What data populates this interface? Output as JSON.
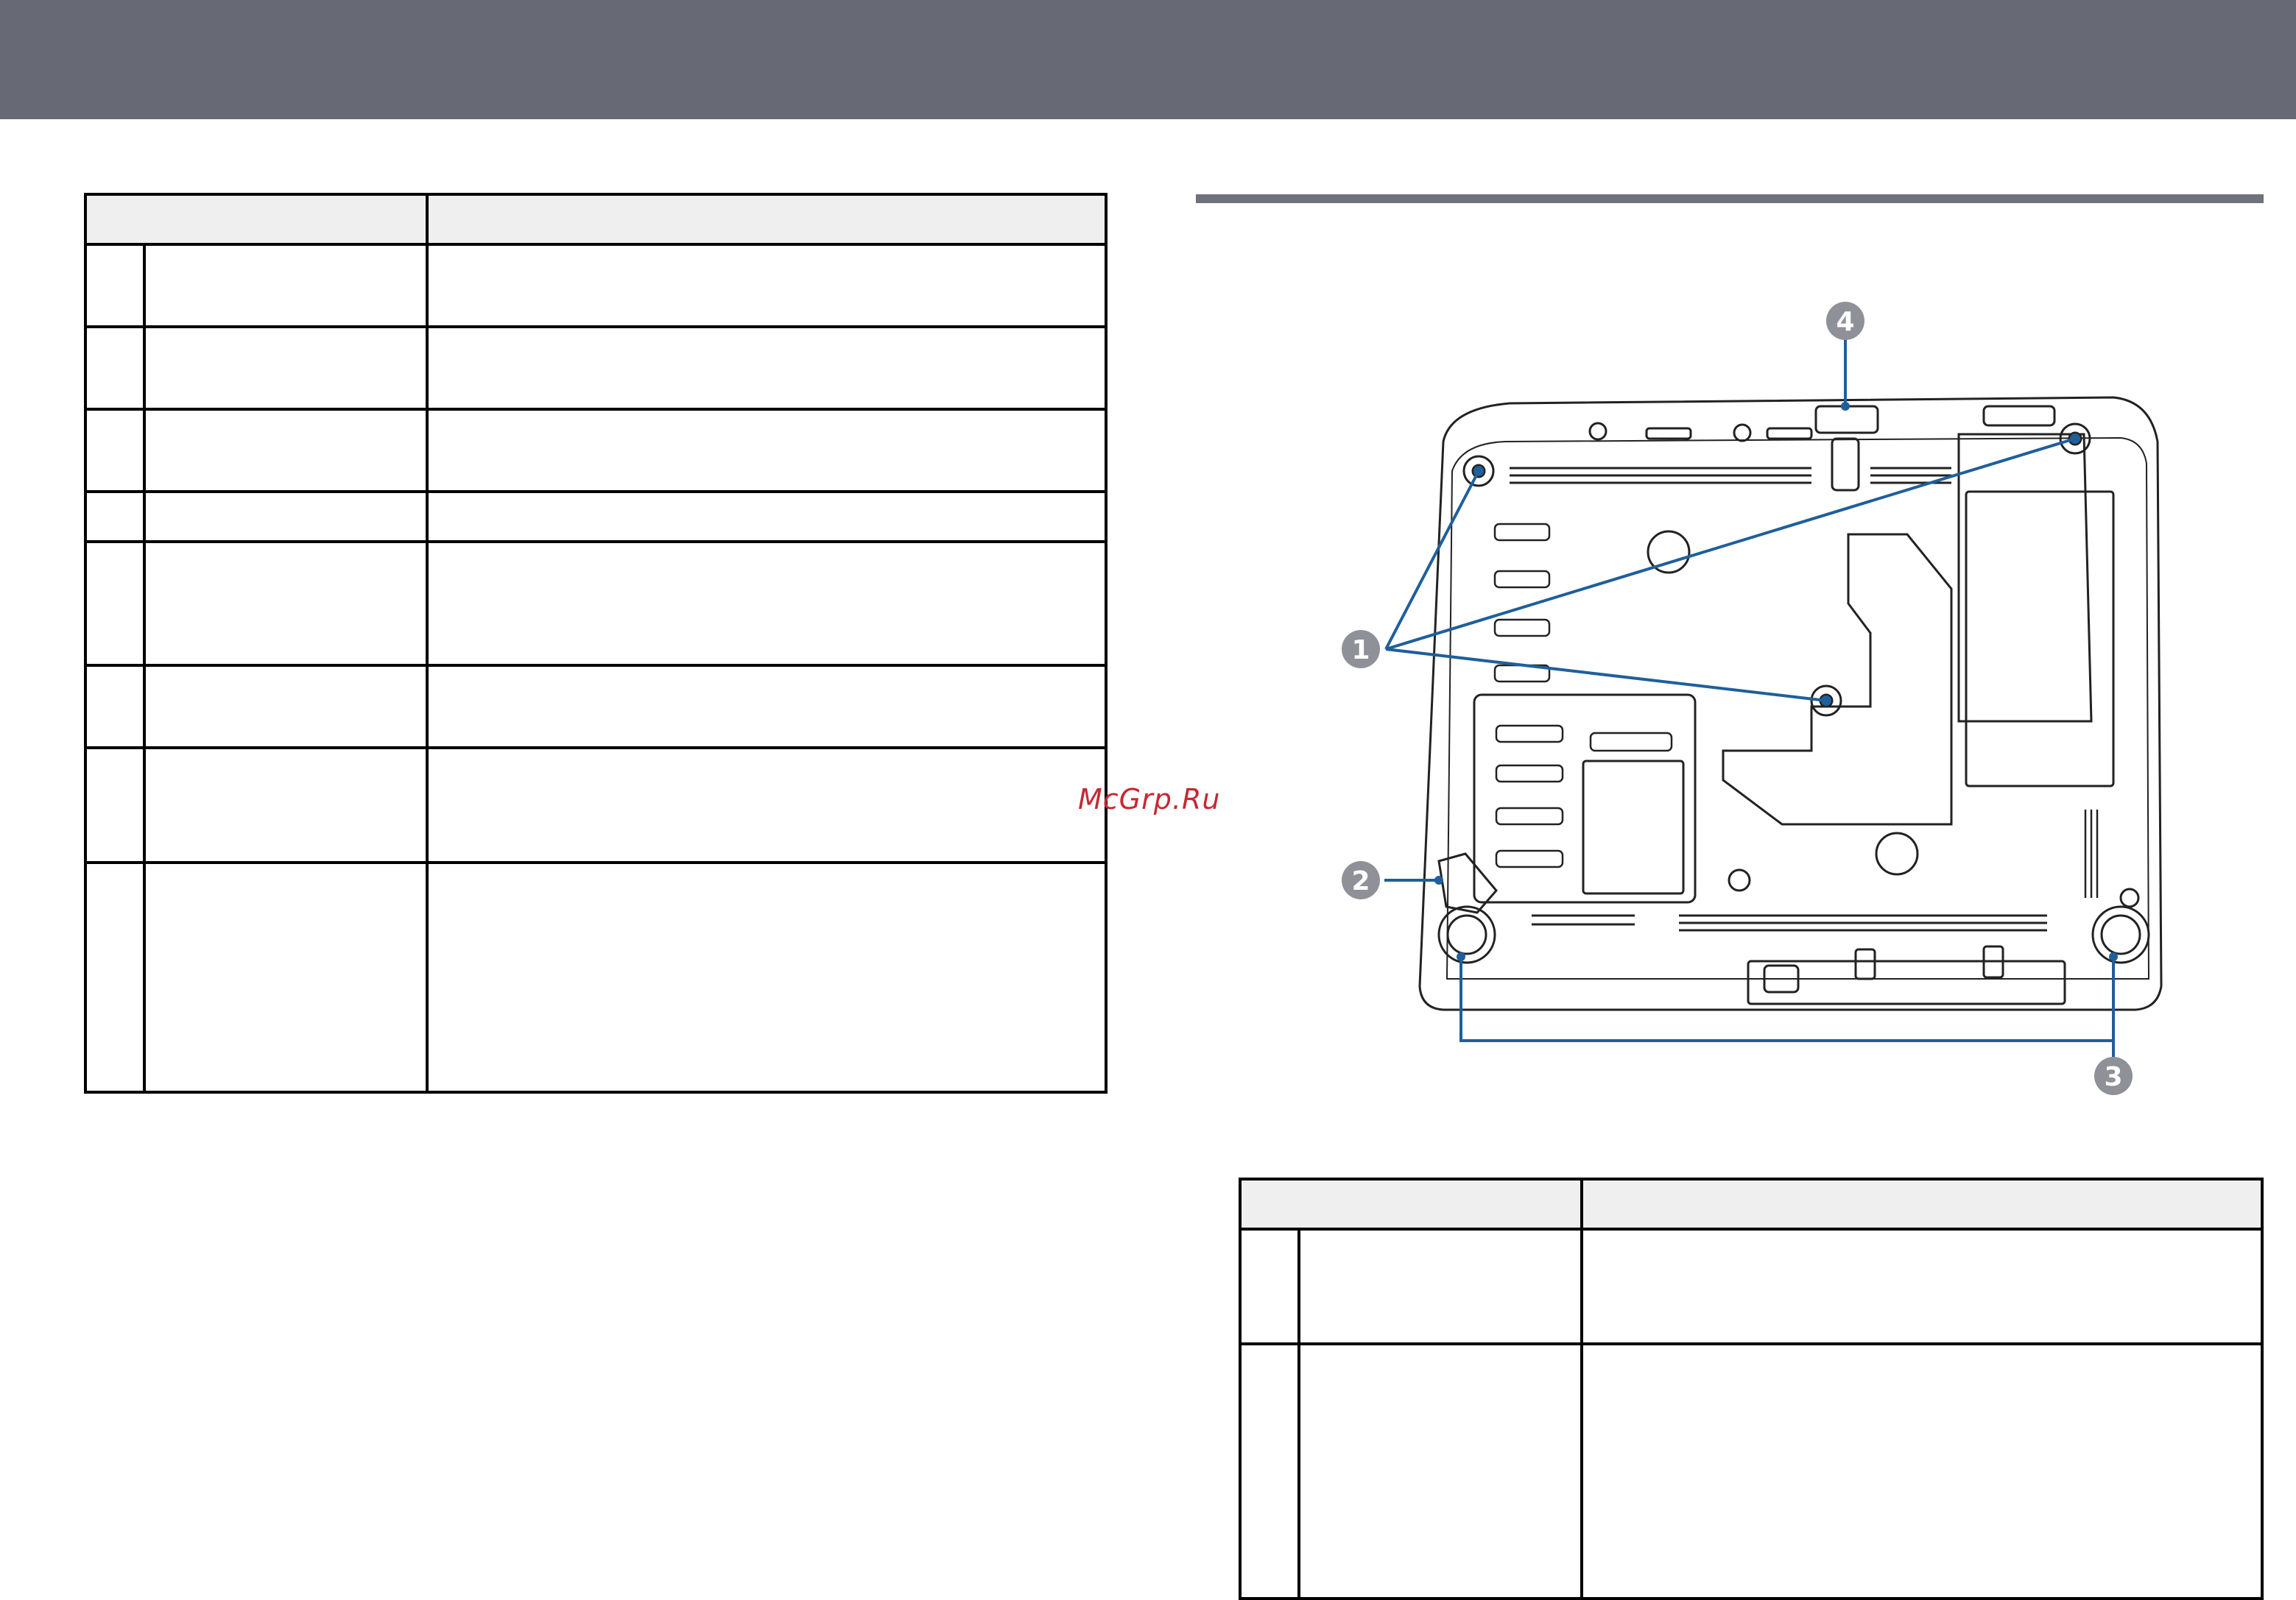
{
  "watermark": "McGrp.Ru",
  "callouts": [
    {
      "id": "callout-1",
      "label": "1"
    },
    {
      "id": "callout-2",
      "label": "2"
    },
    {
      "id": "callout-3",
      "label": "3"
    },
    {
      "id": "callout-4",
      "label": "4"
    }
  ],
  "colors": {
    "header_bar": "#676a74",
    "callout_fill": "#8f9198",
    "leader_line": "#1f5f9b",
    "watermark": "#c62832"
  }
}
